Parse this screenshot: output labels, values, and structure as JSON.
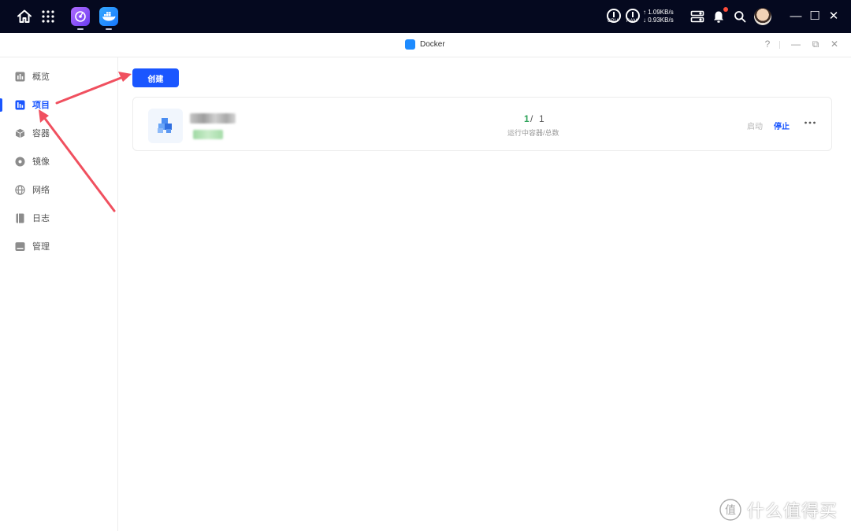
{
  "taskbar": {
    "cpu_label": "CPU",
    "ram_label": "RAM",
    "upload": "↑ 1.09KB/s",
    "download": "↓ 0.93KB/s",
    "minimize": "—",
    "maximize": "☐",
    "close": "✕"
  },
  "window": {
    "title": "Docker",
    "help": "?",
    "minimize": "—",
    "restore": "⧉",
    "close": "✕"
  },
  "sidebar": {
    "items": [
      {
        "label": "概览",
        "icon": "chart-icon"
      },
      {
        "label": "项目",
        "icon": "project-icon",
        "active": true
      },
      {
        "label": "容器",
        "icon": "cube-icon"
      },
      {
        "label": "镜像",
        "icon": "disc-icon"
      },
      {
        "label": "网络",
        "icon": "globe-icon"
      },
      {
        "label": "日志",
        "icon": "log-icon"
      },
      {
        "label": "管理",
        "icon": "manage-icon"
      }
    ]
  },
  "main": {
    "create_label": "创建",
    "project": {
      "running": "1",
      "separator": "/",
      "total": "1",
      "count_label": "运行中容器/总数",
      "start_label": "启动",
      "stop_label": "停止",
      "more_label": "···"
    }
  },
  "watermark": {
    "text": "什么值得买",
    "logo_char": "值"
  },
  "colors": {
    "accent": "#1a56ff",
    "taskbar_bg": "#05091f",
    "running_green": "#2fa35a",
    "annotation_red": "#f0505f"
  }
}
